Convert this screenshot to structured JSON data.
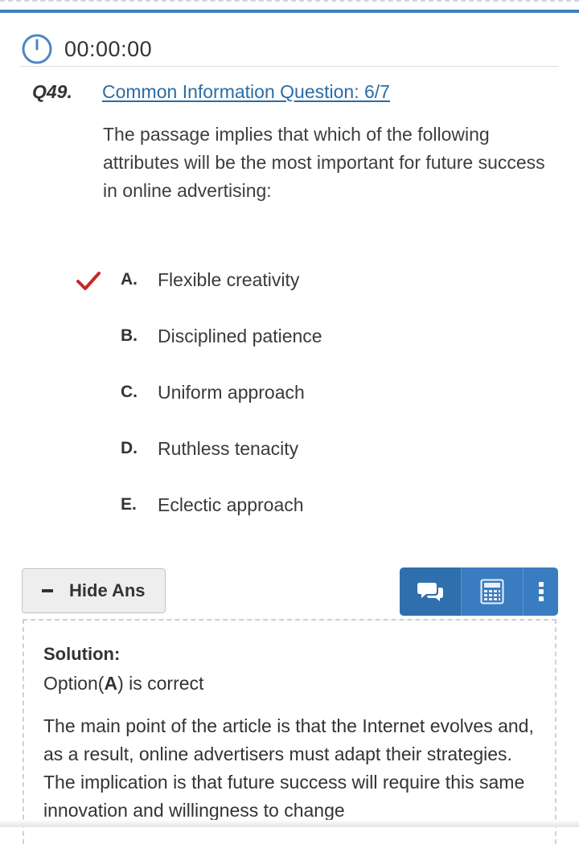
{
  "timer": {
    "value": "00:00:00"
  },
  "question": {
    "number": "Q49.",
    "link_text": "Common Information Question: 6/7",
    "text": "The passage implies that which of the following attributes will be the most important for future success in online advertising:"
  },
  "options": [
    {
      "letter": "A.",
      "text": "Flexible creativity",
      "selected": true
    },
    {
      "letter": "B.",
      "text": "Disciplined patience",
      "selected": false
    },
    {
      "letter": "C.",
      "text": "Uniform approach",
      "selected": false
    },
    {
      "letter": "D.",
      "text": "Ruthless tenacity",
      "selected": false
    },
    {
      "letter": "E.",
      "text": "Eclectic approach",
      "selected": false
    }
  ],
  "toolbar": {
    "hide_label": "Hide Ans",
    "icons": [
      "chat-icon",
      "calculator-icon",
      "more-vertical-icon"
    ]
  },
  "solution": {
    "title": "Solution:",
    "option_prefix": "Option(",
    "option_letter": "A",
    "option_suffix": ") is correct",
    "text": "The main point of the article is that the Internet evolves and, as a result, online advertisers must adapt their strategies. The implication is that future success will require this same innovation and willingness to change"
  },
  "colors": {
    "accent": "#3f7fbf",
    "link": "#2b6ca6",
    "check": "#c62828",
    "tool_bar": "#3a7cc0"
  }
}
